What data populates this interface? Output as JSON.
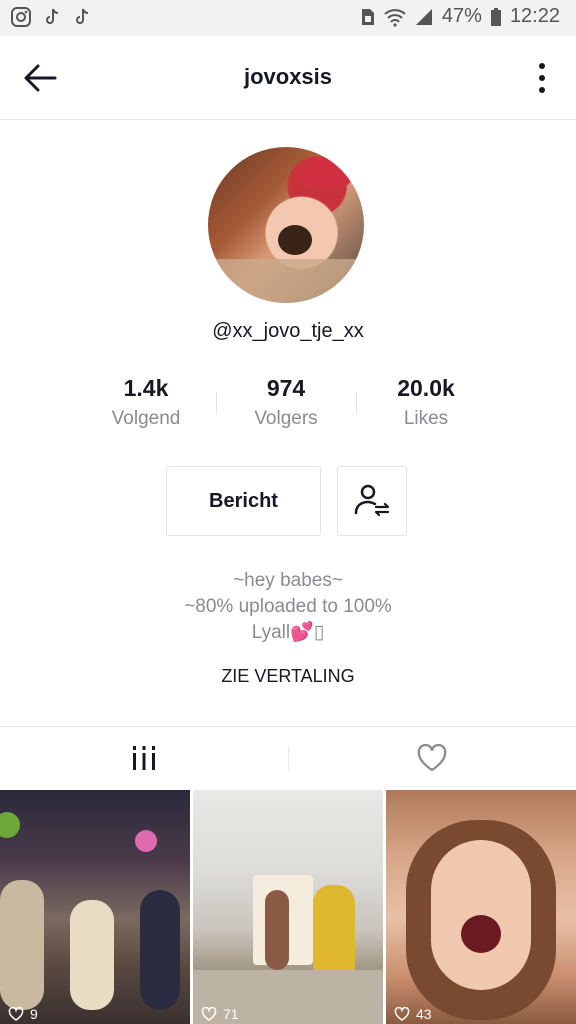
{
  "status_bar": {
    "battery": "47%",
    "time": "12:22",
    "icons_left": [
      "instagram-icon",
      "tiktok-icon",
      "tiktok-icon"
    ],
    "icons_right": [
      "sim-icon",
      "wifi-icon",
      "signal-icon",
      "battery-icon"
    ]
  },
  "header": {
    "title": "jovoxsis",
    "back_icon": "back-arrow-icon",
    "more_icon": "more-vertical-icon"
  },
  "profile": {
    "handle": "@xx_jovo_tje_xx",
    "stats": [
      {
        "value": "1.4k",
        "label": "Volgend"
      },
      {
        "value": "974",
        "label": "Volgers"
      },
      {
        "value": "20.0k",
        "label": "Likes"
      }
    ],
    "message_button": "Bericht",
    "follow_icon": "user-swap-icon",
    "bio": [
      "~hey babes~",
      "~80% uploaded to 100%",
      "Lyall💕▯"
    ],
    "translate_label": "ZIE VERTALING"
  },
  "tabs": [
    {
      "name": "videos",
      "icon": "grid-bars-icon"
    },
    {
      "name": "liked",
      "icon": "heart-icon"
    }
  ],
  "videos": [
    {
      "likes": "9"
    },
    {
      "likes": "71"
    },
    {
      "likes": "43"
    }
  ],
  "colors": {
    "text_primary": "#161823",
    "text_secondary": "#8a8b91",
    "border": "#e3e3e4",
    "status_bar_bg": "#f2f2f2"
  }
}
